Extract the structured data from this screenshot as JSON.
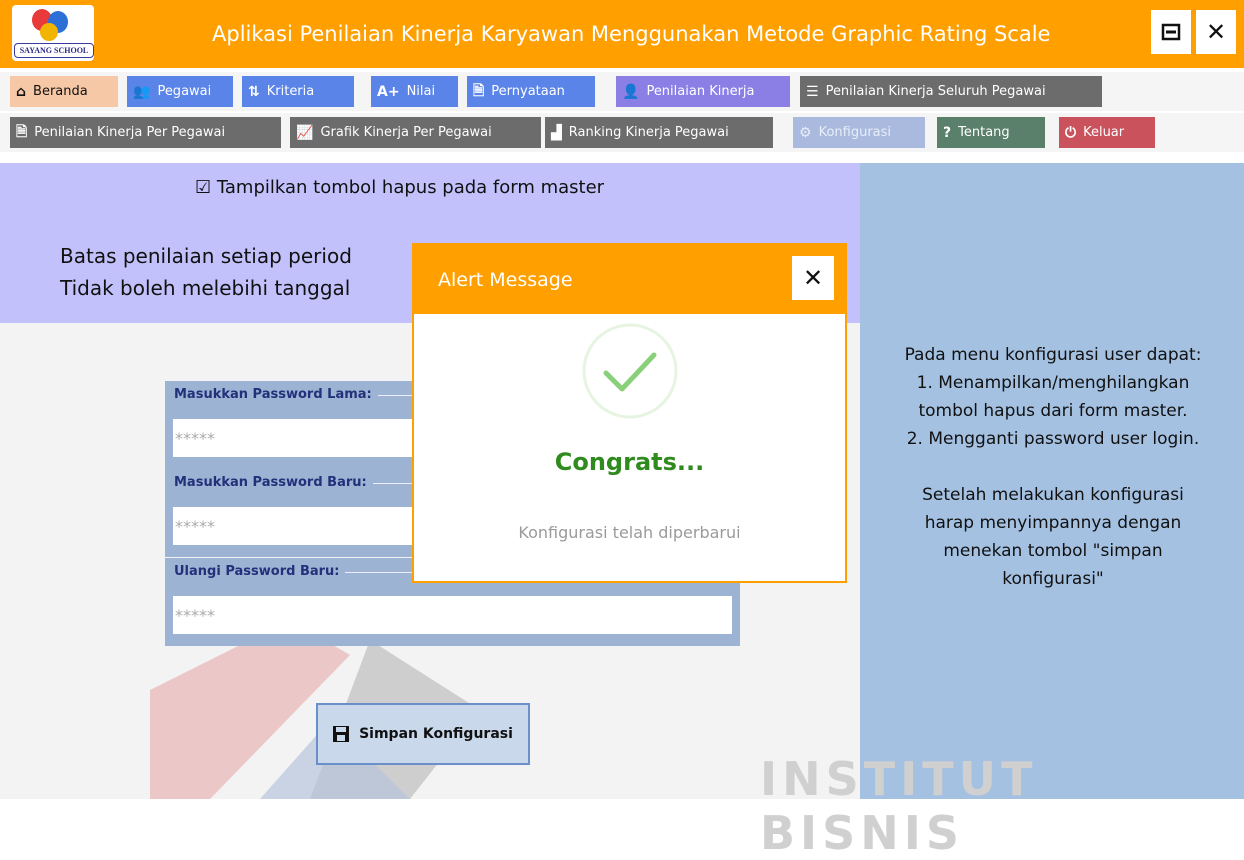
{
  "app": {
    "title": "Aplikasi Penilaian Kinerja Karyawan Menggunakan Metode Graphic Rating Scale",
    "logo_text": "SAYANG SCHOOL",
    "minimize_symbol": "🗕",
    "close_symbol": "✕"
  },
  "menu_row1": [
    {
      "label": "Beranda",
      "icon": "home-icon",
      "glyph": "⌂"
    },
    {
      "label": "Pegawai",
      "icon": "users-icon",
      "glyph": "👥"
    },
    {
      "label": "Kriteria",
      "icon": "sort-az-icon",
      "glyph": "⇅"
    },
    {
      "label": "Nilai",
      "icon": "grade-icon",
      "glyph": "A+"
    },
    {
      "label": "Pernyataan",
      "icon": "document-icon",
      "glyph": "🗎"
    },
    {
      "label": "Penilaian Kinerja",
      "icon": "person-icon",
      "glyph": "👤"
    },
    {
      "label": "Penilaian Kinerja Seluruh Pegawai",
      "icon": "list-icon",
      "glyph": "☰"
    }
  ],
  "menu_row2": [
    {
      "label": "Penilaian Kinerja Per Pegawai",
      "icon": "document-icon",
      "glyph": "🗎"
    },
    {
      "label": "Grafik Kinerja Per Pegawai",
      "icon": "chart-icon",
      "glyph": "📈"
    },
    {
      "label": "Ranking Kinerja Pegawai",
      "icon": "ranking-icon",
      "glyph": "▟"
    },
    {
      "label": "Konfigurasi",
      "icon": "gear-icon",
      "glyph": "⚙"
    },
    {
      "label": "Tentang",
      "icon": "question-icon",
      "glyph": "?"
    },
    {
      "label": "Keluar",
      "icon": "power-icon",
      "glyph": "⏻"
    }
  ],
  "colors": {
    "orange": "#ff9f00",
    "beranda": "#f7c8a6",
    "blue": "#5b84e8",
    "purple": "#8b7fe6",
    "dark_gray": "#6c6c6c",
    "konfigurasi": "#aab9de",
    "tentang": "#5a7f6b",
    "keluar": "#c9525c"
  },
  "config": {
    "checkbox_glyph": "☑",
    "show_delete_label": "Tampilkan tombol hapus pada form master",
    "batas_line1": "Batas penilaian setiap period",
    "batas_line2": "Tidak boleh melebihi tanggal",
    "old_password_label": "Masukkan Password Lama:",
    "new_password_label": "Masukkan Password Baru:",
    "repeat_password_label": "Ulangi Password Baru:",
    "old_password_value": "*****",
    "new_password_value": "*****",
    "repeat_password_value": "*****",
    "save_button_label": "Simpan Konfigurasi",
    "save_icon_glyph": "💾"
  },
  "help_text": {
    "line1": "Pada menu konfigurasi user dapat:",
    "line2": "1. Menampilkan/menghilangkan",
    "line3": "tombol hapus dari form master.",
    "line4": "2. Mengganti password user login.",
    "line5": "Setelah melakukan konfigurasi",
    "line6": "harap menyimpannya dengan",
    "line7": "menekan tombol \"simpan",
    "line8": "konfigurasi\""
  },
  "watermark": "INSTITUT BISNIS",
  "alert": {
    "title": "Alert Message",
    "close_symbol": "✕",
    "heading": "Congrats...",
    "message": "Konfigurasi telah diperbarui"
  }
}
